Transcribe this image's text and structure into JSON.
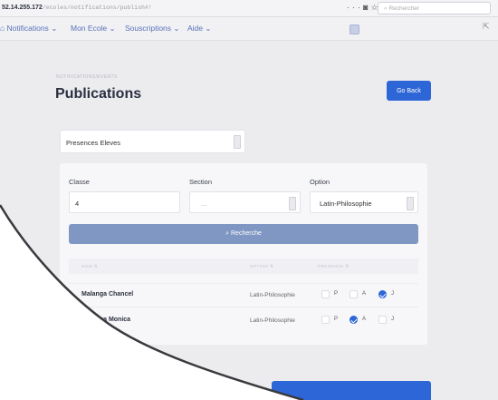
{
  "browser": {
    "url_host": "52.14.255.172",
    "url_path": "/ecoles/notifications/publish#!",
    "search_placeholder": "Rechercher"
  },
  "nav": {
    "items": [
      "Notifications",
      "Mon Ecole",
      "Souscriptions",
      "Aide"
    ]
  },
  "page": {
    "breadcrumb": "NOTIFICATIONS/EVENTS",
    "title": "Publications",
    "go_back": "Go Back"
  },
  "filters": {
    "type_value": "Presences Eleves",
    "classe_label": "Classe",
    "classe_value": "4",
    "section_label": "Section",
    "section_value": "...",
    "option_label": "Option",
    "option_value": "Latin-Philosophie",
    "search_button": "Recherche"
  },
  "table": {
    "headers": [
      "NOM ⇅",
      "OPTION ⇅",
      "PRESENCE ⇅"
    ],
    "rows": [
      {
        "name": "Malanga Chancel",
        "option": "Latin-Philosophie",
        "checks": [
          "P",
          "A",
          "J"
        ],
        "selected": "J"
      },
      {
        "name": "Malanga Monica",
        "option": "Latin-Philosophie",
        "checks": [
          "P",
          "A",
          "J"
        ],
        "selected": "A"
      }
    ]
  },
  "colors": {
    "primary": "#2d66d6",
    "search_button": "#7f97c2",
    "nav_link": "#5872b8",
    "page_bg": "#ececef",
    "curl_bg": "#ffffff"
  }
}
